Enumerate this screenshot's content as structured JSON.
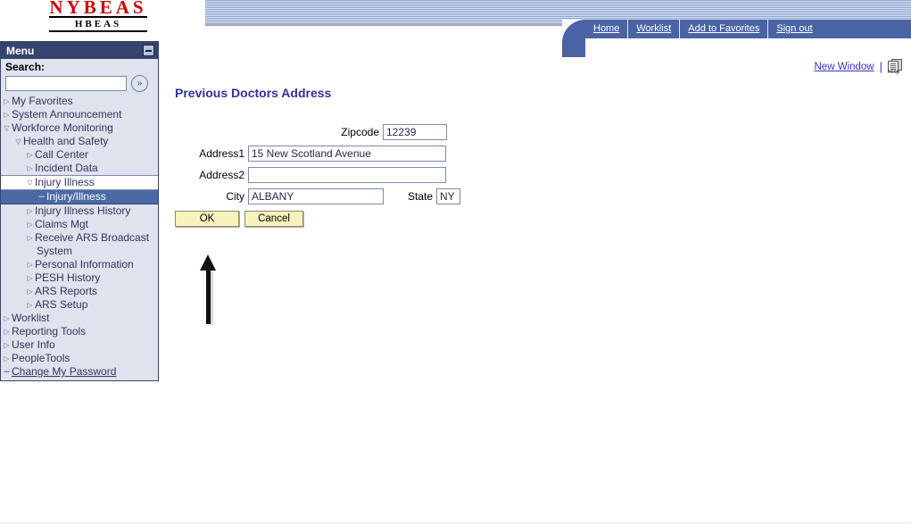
{
  "header": {
    "logo_main": "NYBEAS",
    "logo_sub": "HBEAS",
    "nav_links": [
      "Home",
      "Worklist",
      "Add to Favorites",
      "Sign out"
    ]
  },
  "toolbar": {
    "new_window_label": "New Window",
    "separator": "|",
    "http_icon_label": "http"
  },
  "sidebar": {
    "title": "Menu",
    "minimize_label": "–",
    "search_label": "Search:",
    "search_value": "",
    "search_placeholder": "",
    "go_icon": "»",
    "items": [
      {
        "label": "My Favorites",
        "level": 1,
        "marker": "collapsed",
        "state": "normal"
      },
      {
        "label": "System Announcement",
        "level": 1,
        "marker": "collapsed",
        "state": "normal"
      },
      {
        "label": "Workforce Monitoring",
        "level": 1,
        "marker": "expanded",
        "state": "normal"
      },
      {
        "label": "Health and Safety",
        "level": 2,
        "marker": "expanded",
        "state": "normal"
      },
      {
        "label": "Call Center",
        "level": 3,
        "marker": "collapsed",
        "state": "normal"
      },
      {
        "label": "Incident Data",
        "level": 3,
        "marker": "collapsed",
        "state": "normal"
      },
      {
        "label": "Injury Illness",
        "level": 3,
        "marker": "expanded",
        "state": "open-row"
      },
      {
        "label": "Injury/Illness",
        "level": 4,
        "marker": "leaf",
        "state": "selected"
      },
      {
        "label": "Injury Illness History",
        "level": 3,
        "marker": "collapsed",
        "state": "normal"
      },
      {
        "label": "Claims Mgt",
        "level": 3,
        "marker": "collapsed",
        "state": "normal"
      },
      {
        "label": "Receive ARS Broadcast",
        "level": 3,
        "marker": "collapsed",
        "state": "normal",
        "wrap": "System"
      },
      {
        "label": "Personal Information",
        "level": 3,
        "marker": "collapsed",
        "state": "normal"
      },
      {
        "label": "PESH History",
        "level": 3,
        "marker": "collapsed",
        "state": "normal"
      },
      {
        "label": "ARS Reports",
        "level": 3,
        "marker": "collapsed",
        "state": "normal"
      },
      {
        "label": "ARS Setup",
        "level": 3,
        "marker": "collapsed",
        "state": "normal"
      },
      {
        "label": "Worklist",
        "level": 1,
        "marker": "collapsed",
        "state": "normal"
      },
      {
        "label": "Reporting Tools",
        "level": 1,
        "marker": "collapsed",
        "state": "normal"
      },
      {
        "label": "User Info",
        "level": 1,
        "marker": "collapsed",
        "state": "normal"
      },
      {
        "label": "PeopleTools",
        "level": 1,
        "marker": "collapsed",
        "state": "normal"
      },
      {
        "label": "Change My Password",
        "level": 1,
        "marker": "leaf",
        "state": "link"
      }
    ]
  },
  "main": {
    "page_title": "Previous Doctors Address",
    "fields": [
      {
        "label": "Zipcode",
        "value": "12239",
        "name": "zipcode"
      },
      {
        "label": "Address1",
        "value": "15 New Scotland Avenue",
        "name": "address1"
      },
      {
        "label": "Address2",
        "value": "",
        "name": "address2"
      },
      {
        "label": "City",
        "value": "ALBANY",
        "name": "city"
      },
      {
        "label": "State",
        "value": "NY",
        "name": "state"
      }
    ],
    "buttons": {
      "ok": "OK",
      "cancel": "Cancel"
    }
  },
  "colors": {
    "brand_red": "#cc0000",
    "menu_header": "#36436e",
    "nav_bar": "#4a63a5",
    "selected_row": "#4a6aa5",
    "title_blue": "#333399",
    "button_yellow": "#f8f2bd"
  }
}
